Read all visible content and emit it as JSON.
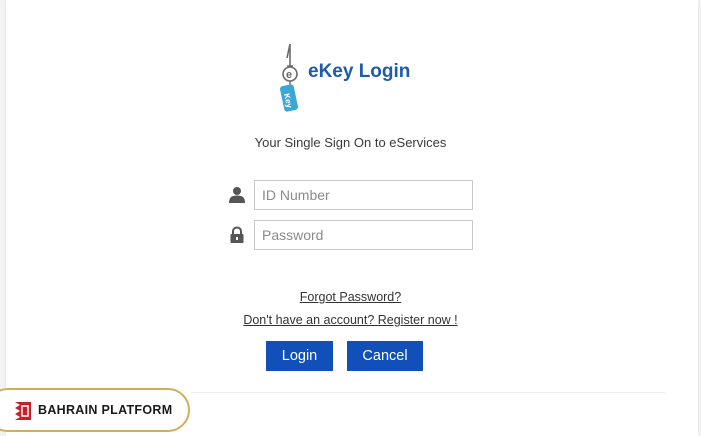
{
  "logo": {
    "title": "eKey Login",
    "icon": "ekey-keychain-logo"
  },
  "tagline": "Your Single Sign On to eServices",
  "form": {
    "id_field": {
      "placeholder": "ID Number",
      "value": "",
      "icon": "user-icon"
    },
    "password_field": {
      "placeholder": "Password",
      "value": "",
      "icon": "lock-icon"
    }
  },
  "links": {
    "forgot_password": "Forgot Password?",
    "register": "Don't have an account? Register now !"
  },
  "buttons": {
    "login": "Login",
    "cancel": "Cancel"
  },
  "badge": {
    "label": "BAHRAIN PLATFORM",
    "icon": "bahrain-platform-icon"
  },
  "colors": {
    "brand_blue": "#1050b8",
    "logo_text": "#1d5cad",
    "key_tag": "#3aa7d6",
    "badge_border": "#cfae5c",
    "badge_red": "#c8202b"
  }
}
